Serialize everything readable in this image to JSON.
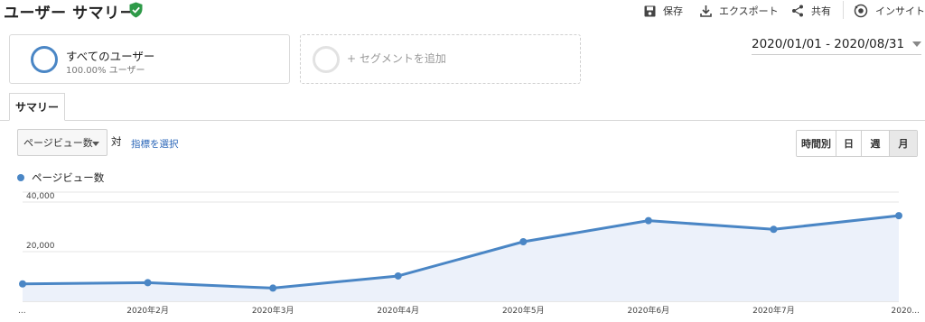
{
  "header": {
    "title": "ユーザー サマリー",
    "tools": {
      "save": "保存",
      "export": "エクスポート",
      "share": "共有",
      "insight": "インサイト"
    }
  },
  "segments": {
    "active": {
      "name": "すべてのユーザー",
      "detail": "100.00% ユーザー"
    },
    "add_label": "+ セグメントを追加"
  },
  "date_range": "2020/01/01 - 2020/08/31",
  "tabs": {
    "summary": "サマリー"
  },
  "controls": {
    "metric": "ページビュー数",
    "vs": "対",
    "select_metric": "指標を選択",
    "granularity": {
      "hour": "時間別",
      "day": "日",
      "week": "週",
      "month": "月",
      "selected": "month"
    }
  },
  "colors": {
    "series": "#4a86c5",
    "area": "#ecf1fa",
    "grid": "#e6e6e6"
  },
  "chart_data": {
    "type": "area",
    "series": [
      {
        "name": "ページビュー数",
        "values": [
          7000,
          7500,
          5300,
          10200,
          24000,
          32500,
          29000,
          34500
        ]
      }
    ],
    "x": [
      "...",
      "2020年2月",
      "2020年3月",
      "2020年4月",
      "2020年5月",
      "2020年6月",
      "2020年7月",
      "2020..."
    ],
    "yticks": [
      "20,000",
      "40,000"
    ],
    "ylim": [
      0,
      44000
    ],
    "grid": true,
    "legend": "top-left"
  }
}
